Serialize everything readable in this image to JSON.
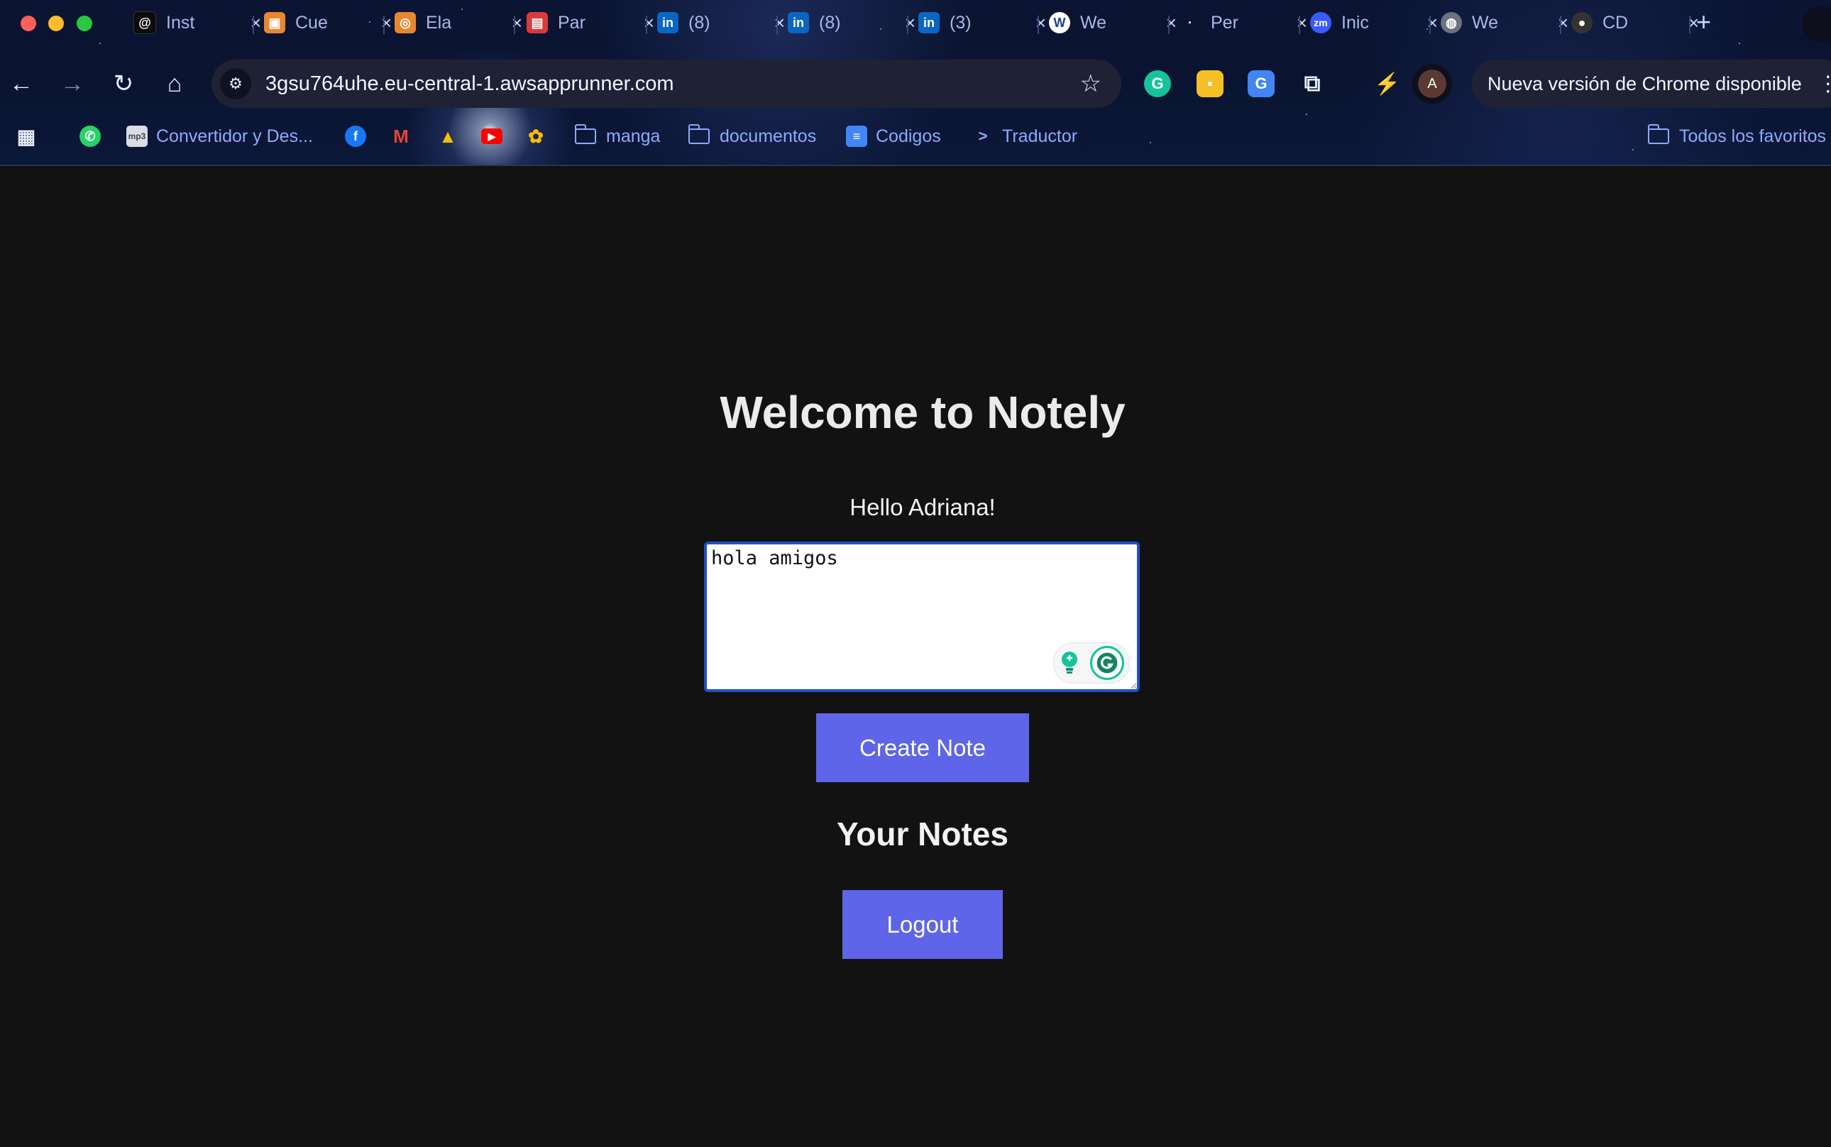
{
  "browser": {
    "tabs": [
      {
        "title": "Inst",
        "icon": "threads-icon",
        "color": "#111111"
      },
      {
        "title": "Cue",
        "icon": "aws-cube-icon",
        "color": "#e8872f"
      },
      {
        "title": "Ela",
        "icon": "aws-elastic-icon",
        "color": "#e8872f"
      },
      {
        "title": "Par",
        "icon": "parameters-icon",
        "color": "#d93b3b"
      },
      {
        "title": "(8)",
        "icon": "linkedin-icon",
        "color": "#0a66c2"
      },
      {
        "title": "(8)",
        "icon": "linkedin-icon",
        "color": "#0a66c2"
      },
      {
        "title": "(3)",
        "icon": "linkedin-icon",
        "color": "#0a66c2"
      },
      {
        "title": "We",
        "icon": "wordpress-icon",
        "color": "#ffffff"
      },
      {
        "title": "Per",
        "icon": "dot-icon",
        "color": "#111111"
      },
      {
        "title": "Inic",
        "icon": "zoom-icon",
        "color": "#3b5bfd"
      },
      {
        "title": "We",
        "icon": "globe-icon",
        "color": "#6b7280"
      },
      {
        "title": "CD",
        "icon": "github-icon",
        "color": "#333333"
      }
    ],
    "new_tab": "+",
    "url": "3gsu764uhe.eu-central-1.awsapprunner.com",
    "profile_initial": "A",
    "update_text": "Nueva versión de Chrome disponible",
    "bookmarks": [
      {
        "label": "",
        "icon": "apps-grid-icon"
      },
      {
        "label": "",
        "icon": "whatsapp-icon"
      },
      {
        "label": "Convertidor y Des...",
        "icon": "converter-icon"
      },
      {
        "label": "",
        "icon": "facebook-icon"
      },
      {
        "label": "",
        "icon": "gmail-icon"
      },
      {
        "label": "",
        "icon": "drive-icon"
      },
      {
        "label": "",
        "icon": "youtube-icon"
      },
      {
        "label": "",
        "icon": "photos-icon"
      },
      {
        "label": "manga",
        "icon": "folder-icon"
      },
      {
        "label": "documentos",
        "icon": "folder-icon"
      },
      {
        "label": "Codigos",
        "icon": "docs-icon"
      },
      {
        "label": "Traductor",
        "icon": "translate-icon"
      },
      {
        "label": "Todos los favoritos",
        "icon": "folder-icon"
      }
    ]
  },
  "page": {
    "title": "Welcome to Notely",
    "greeting": "Hello Adriana!",
    "note_value": "hola amigos",
    "create_button": "Create Note",
    "notes_heading": "Your Notes",
    "logout_button": "Logout",
    "accent_color": "#5e65e8"
  }
}
